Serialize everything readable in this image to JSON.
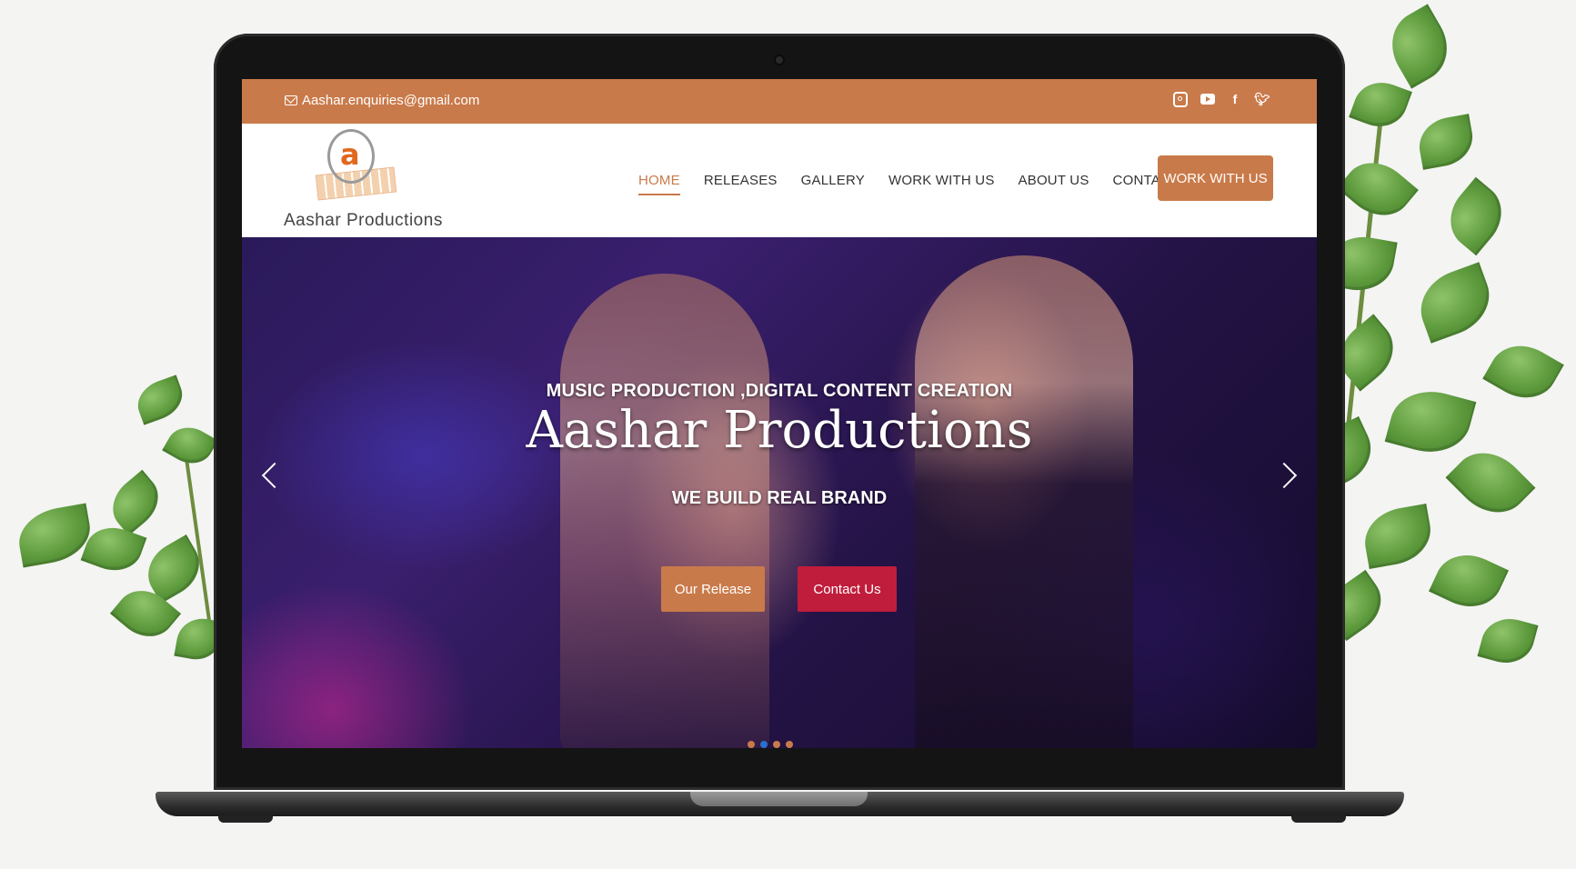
{
  "topbar": {
    "email": "Aashar.enquiries@gmail.com",
    "social_icons": [
      "instagram-icon",
      "youtube-icon",
      "facebook-icon",
      "twitter-icon"
    ],
    "background": "#c97a4a"
  },
  "brand": {
    "logo_text": "Aashar Productions",
    "logo_letter": "a",
    "accent": "#c97a4a"
  },
  "nav": {
    "items": [
      {
        "label": "HOME",
        "active": true
      },
      {
        "label": "RELEASES"
      },
      {
        "label": "GALLERY"
      },
      {
        "label": "WORK WITH US"
      },
      {
        "label": "ABOUT US"
      },
      {
        "label": "CONTACT US"
      }
    ],
    "cta_label": "WORK WITH US"
  },
  "hero": {
    "subtitle": "MUSIC PRODUCTION ,DIGITAL CONTENT CREATION",
    "title": "Aashar Productions",
    "tagline": "WE BUILD REAL BRAND",
    "primary_button": "Our Release",
    "secondary_button": "Contact Us",
    "secondary_color": "#c01d3c",
    "slide_count": 4,
    "active_slide": 3
  }
}
